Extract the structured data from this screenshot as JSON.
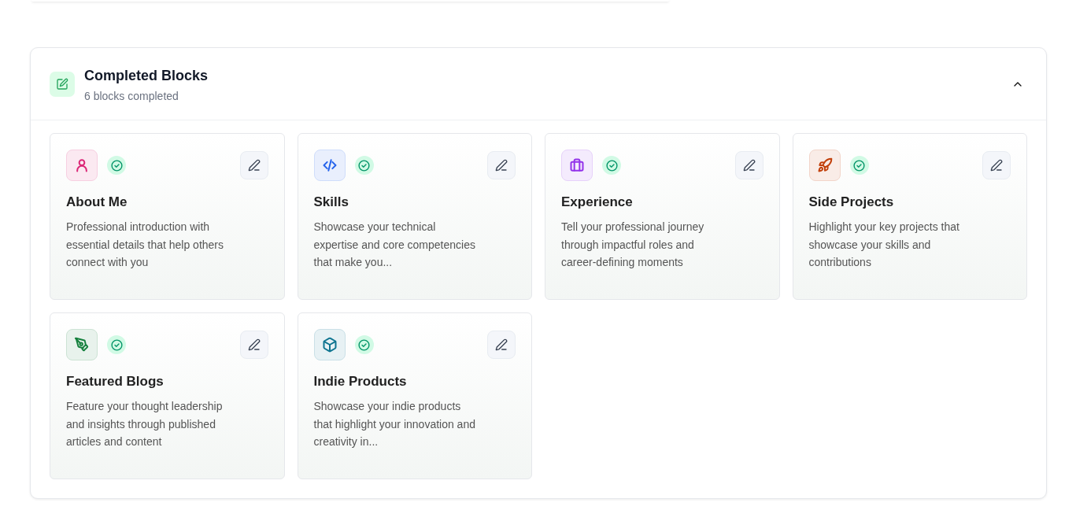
{
  "section": {
    "title": "Completed Blocks",
    "subtitle": "6 blocks completed",
    "expanded": true
  },
  "blocks": [
    {
      "title": "About Me",
      "description": "Professional introduction with essential details that help others connect with you",
      "kind": "person",
      "color": "#db2777",
      "completed": true
    },
    {
      "title": "Skills",
      "description": "Showcase your technical expertise and core competencies that make you...",
      "kind": "code",
      "color": "#2563eb",
      "completed": true
    },
    {
      "title": "Experience",
      "description": "Tell your professional journey through impactful roles and career-defining moments",
      "kind": "briefcase",
      "color": "#9333ea",
      "completed": true
    },
    {
      "title": "Side Projects",
      "description": "Highlight your key projects that showcase your skills and contributions",
      "kind": "rocket",
      "color": "#c2410c",
      "completed": true
    },
    {
      "title": "Featured Blogs",
      "description": "Feature your thought leadership and insights through published articles and content",
      "kind": "pen",
      "color": "#15803d",
      "completed": true
    },
    {
      "title": "Indie Products",
      "description": "Showcase your indie products that highlight your innovation and creativity in...",
      "kind": "package",
      "color": "#0e7490",
      "completed": true
    }
  ]
}
